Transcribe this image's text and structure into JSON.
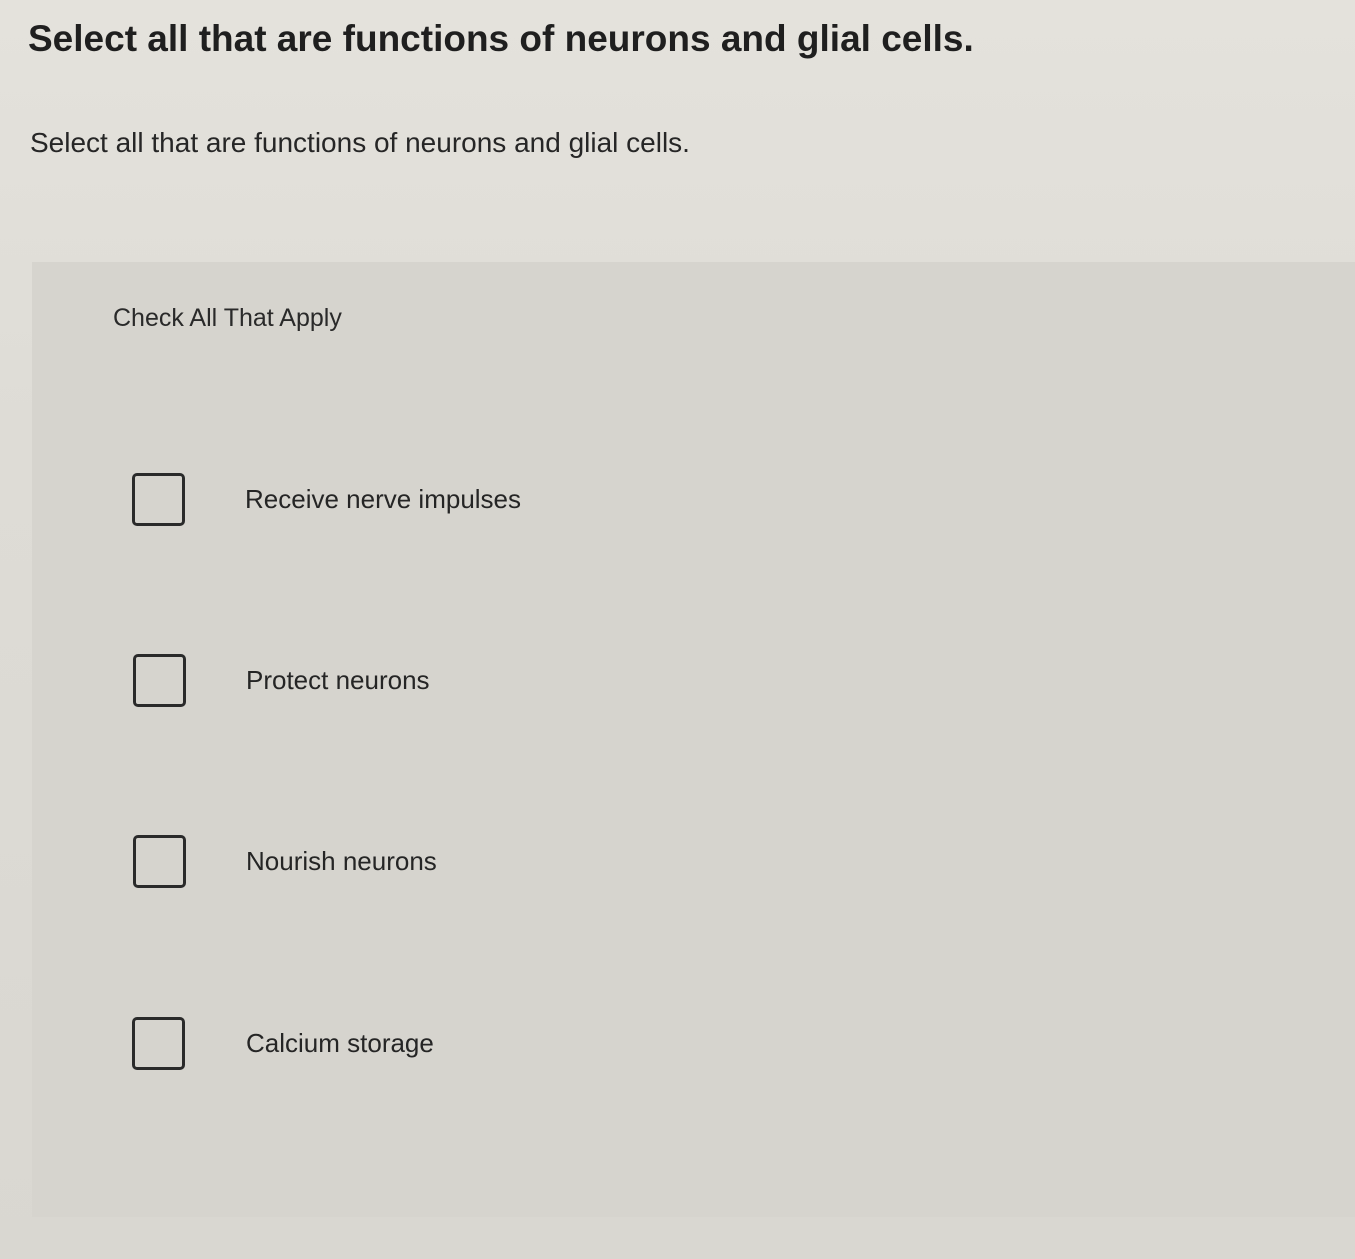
{
  "heading": "Select all that are functions of neurons and glial cells.",
  "question": "Select all that are functions of neurons and glial cells.",
  "instructions": "Check All That Apply",
  "options": [
    {
      "label": "Receive nerve impulses",
      "checked": false
    },
    {
      "label": "Protect neurons",
      "checked": false
    },
    {
      "label": "Nourish neurons",
      "checked": false
    },
    {
      "label": "Calcium storage",
      "checked": false
    }
  ]
}
